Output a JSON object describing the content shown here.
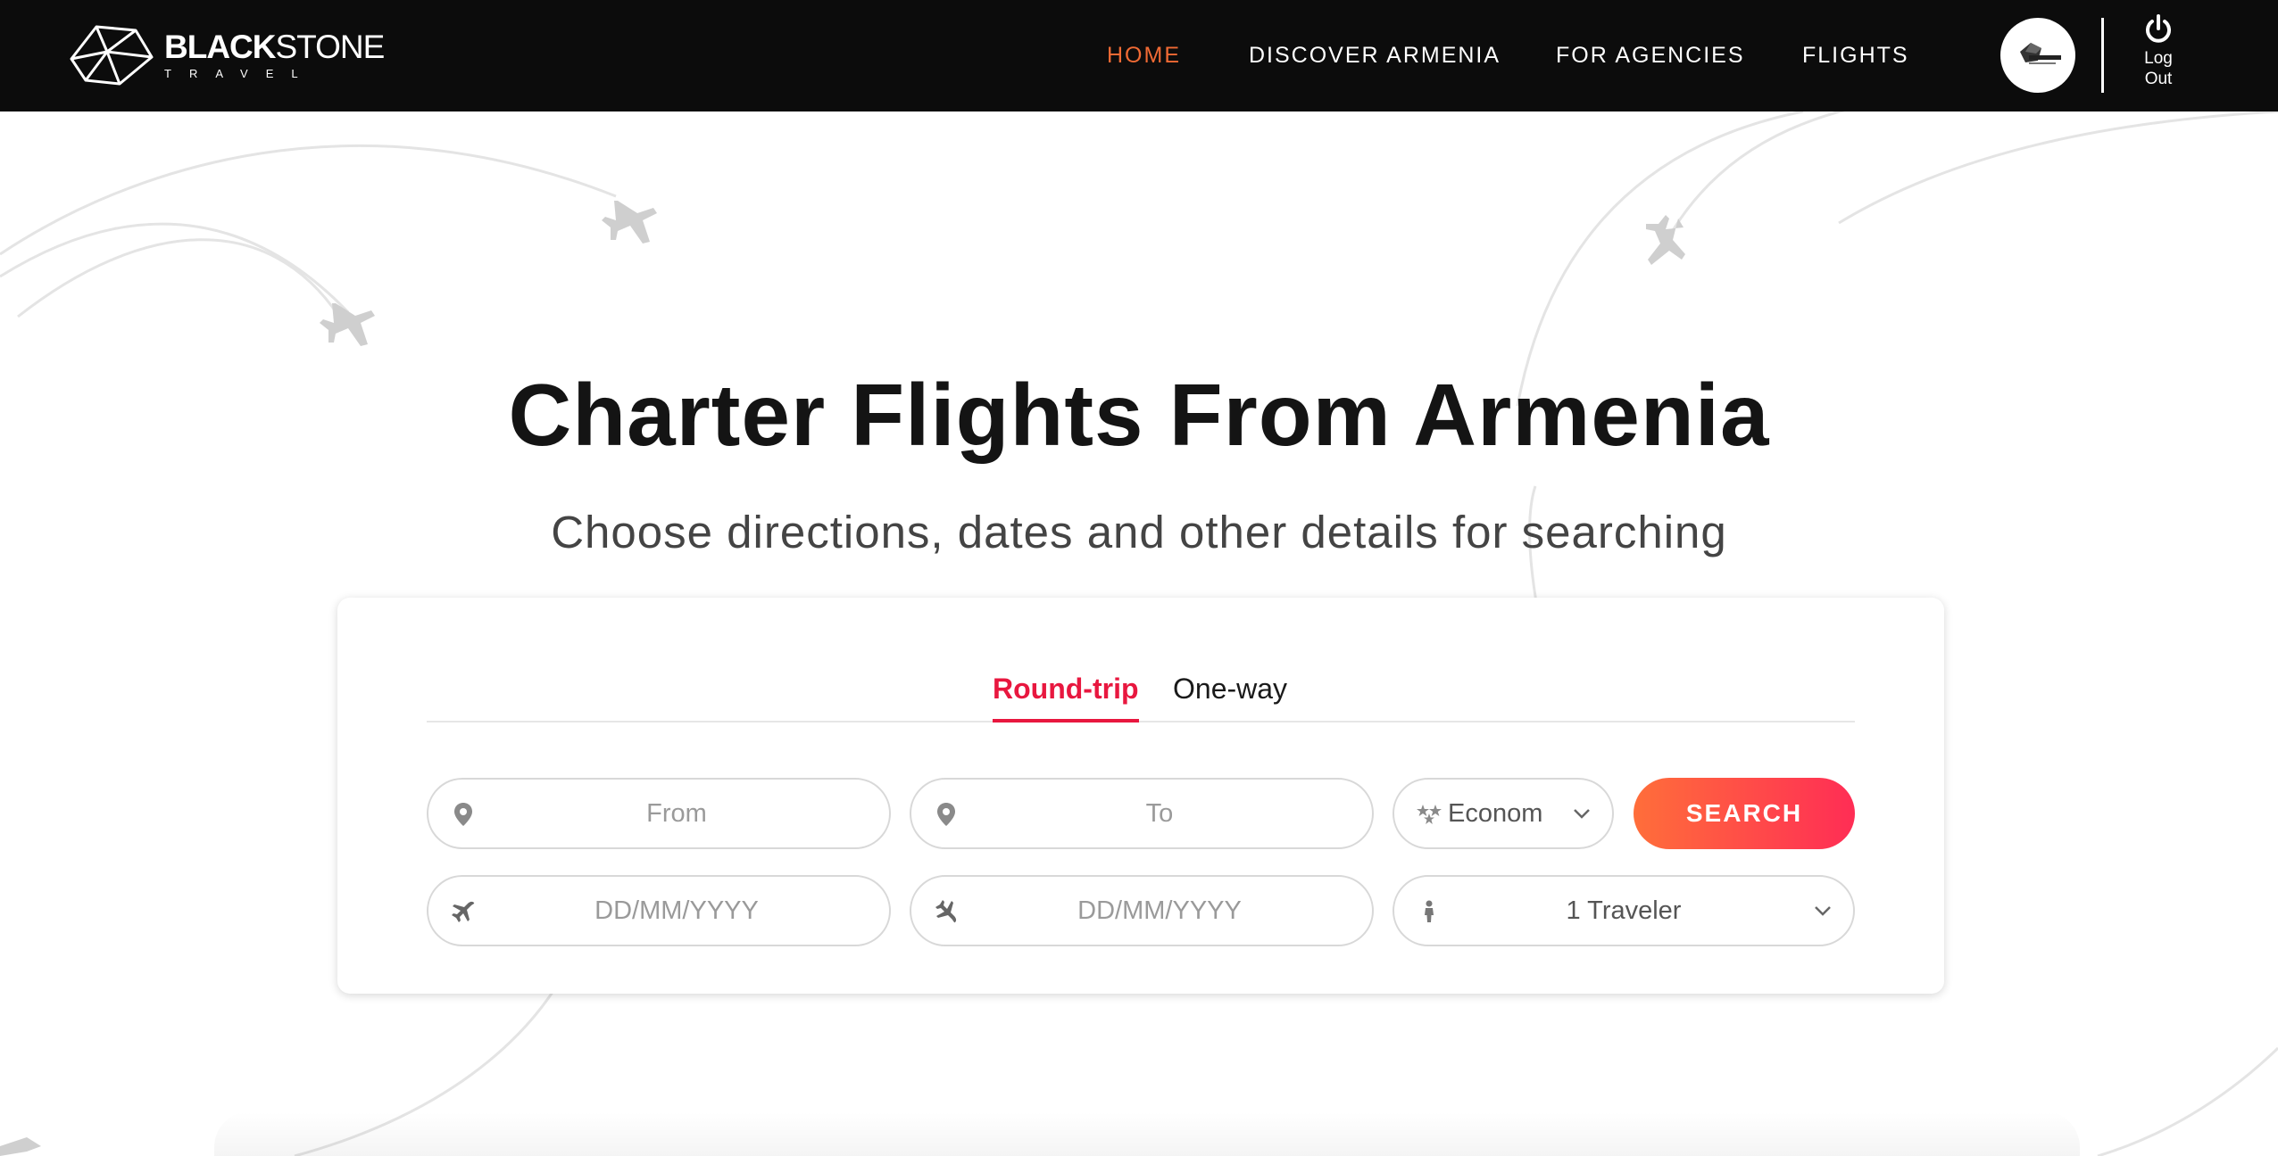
{
  "brand": {
    "name_bold": "BLACK",
    "name_light": "STONE",
    "tagline": "TRAVEL"
  },
  "nav": {
    "items": [
      {
        "label": "HOME",
        "active": true
      },
      {
        "label": "DISCOVER ARMENIA",
        "active": false
      },
      {
        "label": "FOR AGENCIES",
        "active": false
      },
      {
        "label": "FLIGHTS",
        "active": false
      }
    ],
    "logout_label": "Log Out"
  },
  "hero": {
    "title": "Charter Flights From Armenia",
    "subtitle": "Choose directions, dates and other details for searching"
  },
  "search": {
    "tabs": [
      {
        "label": "Round-trip",
        "active": true
      },
      {
        "label": "One-way",
        "active": false
      }
    ],
    "from": {
      "placeholder": "From",
      "icon": "location-pin-icon"
    },
    "to": {
      "placeholder": "To",
      "icon": "location-pin-icon"
    },
    "cabin_class": {
      "value": "Econom",
      "icon": "stars-icon"
    },
    "depart_date": {
      "placeholder": "DD/MM/YYYY",
      "icon": "plane-takeoff-icon"
    },
    "return_date": {
      "placeholder": "DD/MM/YYYY",
      "icon": "plane-landing-icon"
    },
    "travelers": {
      "value": "1 Traveler",
      "icon": "person-icon"
    },
    "submit_label": "SEARCH"
  },
  "colors": {
    "header_bg": "#0c0c0c",
    "nav_active": "#f06a34",
    "tab_active": "#e8173f",
    "button_gradient_start": "#ff6e3a",
    "button_gradient_end": "#ff2d55"
  }
}
